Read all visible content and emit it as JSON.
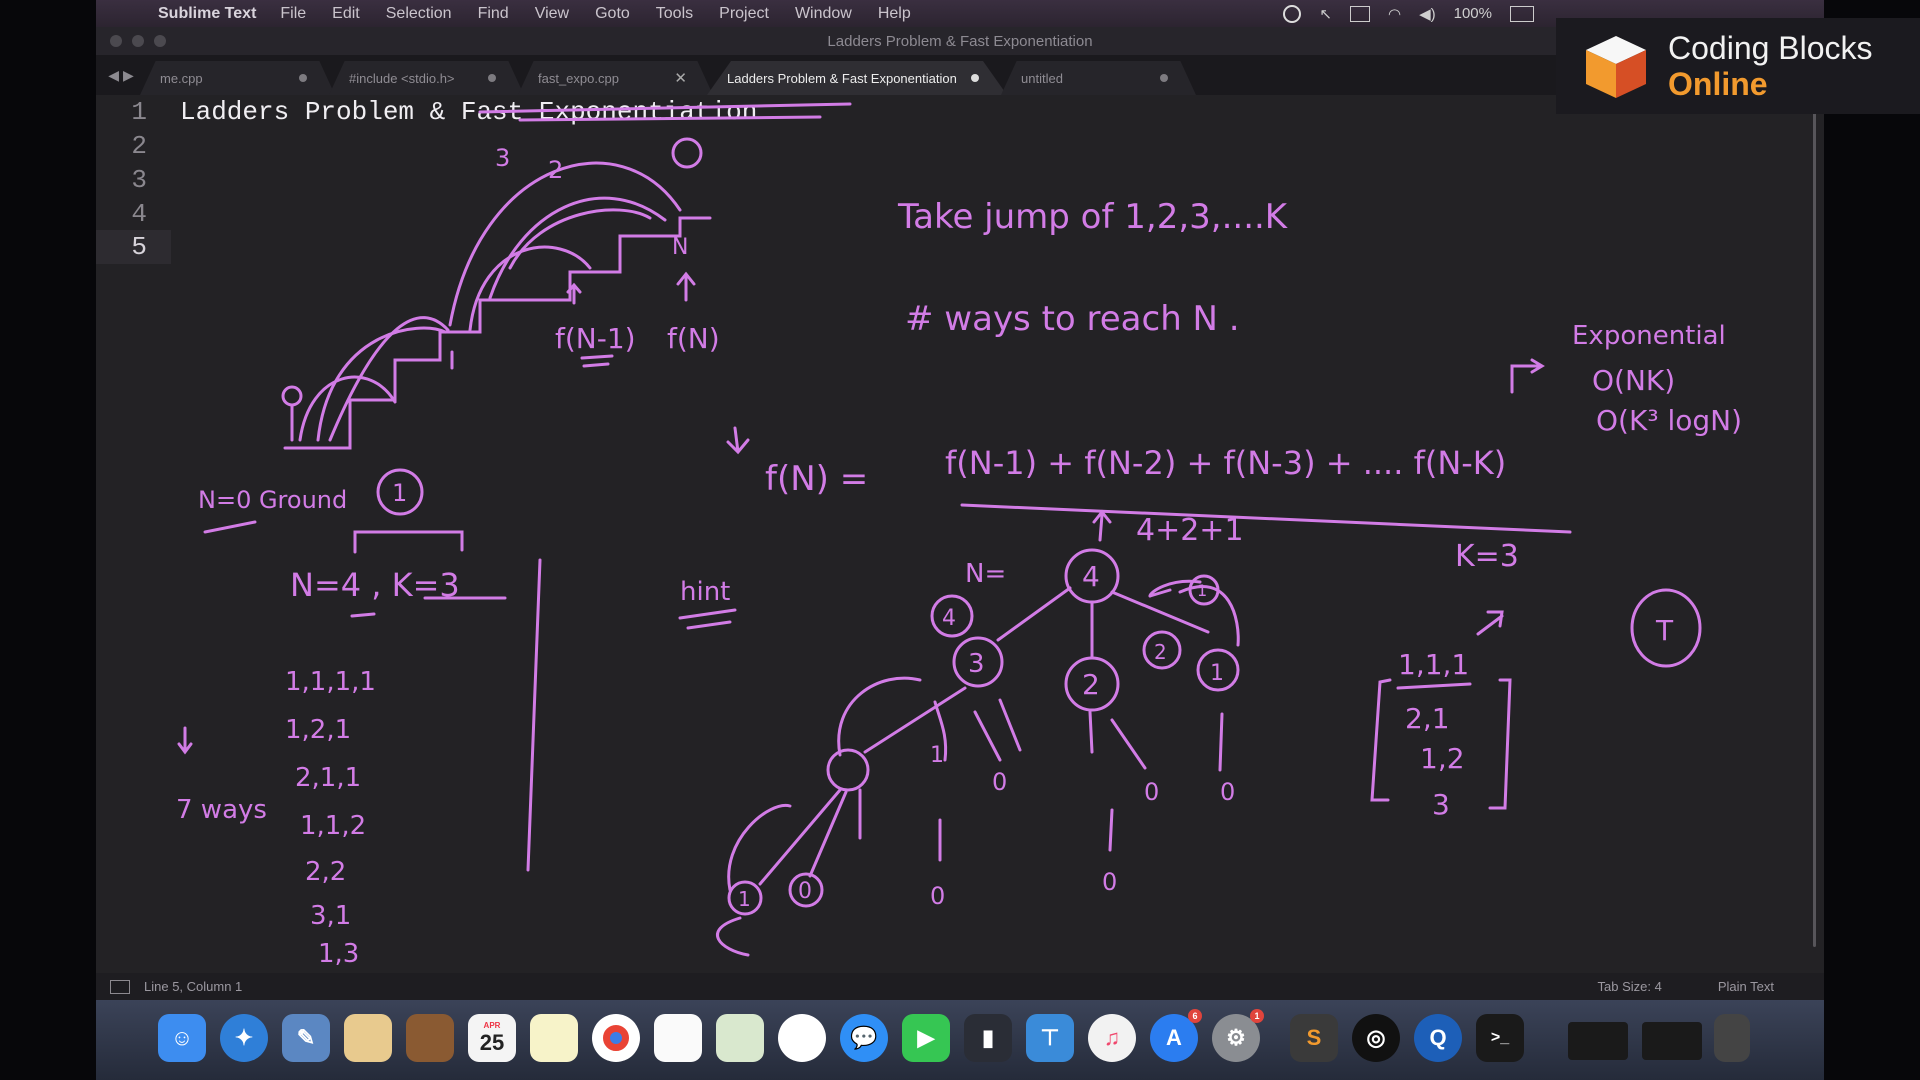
{
  "menubar": {
    "app_name": "Sublime Text",
    "items": [
      "File",
      "Edit",
      "Selection",
      "Find",
      "View",
      "Goto",
      "Tools",
      "Project",
      "Window",
      "Help"
    ],
    "battery": "100%"
  },
  "window": {
    "title": "Ladders Problem & Fast Exponentiation"
  },
  "tabs": [
    {
      "label": "me.cpp",
      "state": "modified"
    },
    {
      "label": "#include <stdio.h>",
      "state": "modified"
    },
    {
      "label": "fast_expo.cpp",
      "state": "close"
    },
    {
      "label": "Ladders Problem & Fast Exponentiation",
      "state": "active-modified"
    },
    {
      "label": "untitled",
      "state": "modified"
    }
  ],
  "editor": {
    "line_numbers": [
      "1",
      "2",
      "3",
      "4",
      "5"
    ],
    "line1": "Ladders Problem & Fast Exponentiation"
  },
  "annotations": {
    "ladder_labels": [
      "3",
      "2",
      "N",
      "f(N-1)",
      "f(N)"
    ],
    "ground": "N=0 Ground",
    "ground_value": "1",
    "params": "N=4 , K=3",
    "ways_list": [
      "1,1,1,1",
      "1,2,1",
      "2,1,1",
      "1,1,2",
      "2,2",
      "3,1",
      "1,3"
    ],
    "ways_count": "7 ways",
    "take_jump": "Take jump of 1,2,3,....K",
    "ways_to_reach": "# ways to reach N .",
    "hint": "hint",
    "fn": "f(N) =",
    "recurrence": "f(N-1) + f(N-2) + f(N-3) + .... f(N-K)",
    "sum": "4+2+1",
    "k_val": "K=3",
    "n_eq": "N=",
    "tree_root": "4",
    "tree_nodes": [
      "4",
      "3",
      "2",
      "1",
      "2",
      "1",
      "0",
      "0",
      "1",
      "0",
      "0",
      "0",
      "0",
      "1"
    ],
    "complexity": [
      "Exponential",
      "O(NK)",
      "O(K³ logN)"
    ],
    "seqs": [
      "1,1,1",
      "2,1",
      "1,2",
      "3"
    ],
    "circled": "T"
  },
  "statusbar": {
    "position": "Line 5, Column 1",
    "tab_size": "Tab Size: 4",
    "syntax": "Plain Text"
  },
  "dock": {
    "calendar_day": "25",
    "calendar_month": "APR",
    "badges": [
      "6",
      "1"
    ]
  },
  "brand": {
    "line1": "Coding Blocks",
    "line2": "Online"
  },
  "colors": {
    "ink": "#d27ce6",
    "editor_bg": "#232225",
    "brand_orange": "#f29a2e"
  }
}
